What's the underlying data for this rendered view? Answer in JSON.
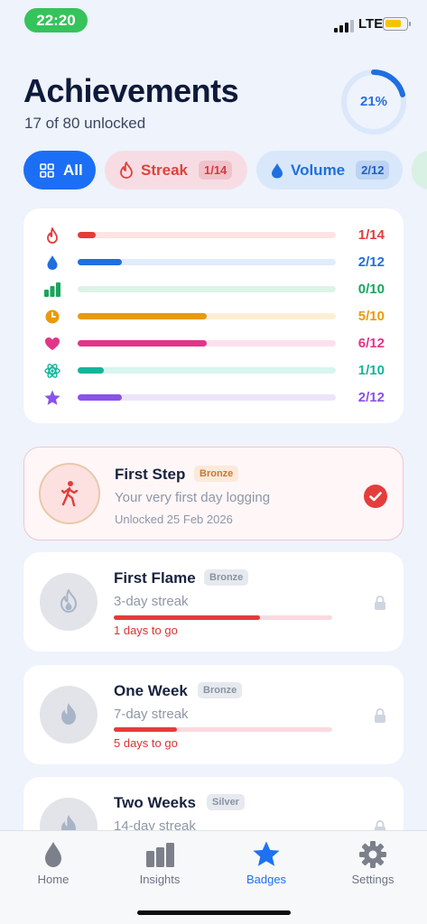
{
  "status": {
    "time": "22:20",
    "network": "LTE"
  },
  "header": {
    "title": "Achievements",
    "subtitle": "17 of 80 unlocked",
    "ring_label": "21%",
    "ring_fraction": 0.21
  },
  "filters": [
    {
      "label": "All",
      "icon": "grid-icon",
      "active": true
    },
    {
      "label": "Streak",
      "count": "1/14",
      "icon": "flame-icon"
    },
    {
      "label": "Volume",
      "count": "2/12",
      "icon": "drop-icon"
    }
  ],
  "categories": [
    {
      "icon": "flame-icon",
      "value": "1/14",
      "fraction": 0.07,
      "color": "#e23c3c",
      "track": "#fde3e3"
    },
    {
      "icon": "drop-icon",
      "value": "2/12",
      "fraction": 0.17,
      "color": "#1f6fe0",
      "track": "#e0ebfb"
    },
    {
      "icon": "bar-chart-icon",
      "value": "0/10",
      "fraction": 0.0,
      "color": "#18a55b",
      "track": "#dcf4e7"
    },
    {
      "icon": "clock-icon",
      "value": "5/10",
      "fraction": 0.5,
      "color": "#e99a0b",
      "track": "#fdefd5"
    },
    {
      "icon": "heart-icon",
      "value": "6/12",
      "fraction": 0.5,
      "color": "#e2358a",
      "track": "#fce0ee"
    },
    {
      "icon": "atom-icon",
      "value": "1/10",
      "fraction": 0.1,
      "color": "#12b59a",
      "track": "#d8f5ef"
    },
    {
      "icon": "star-icon",
      "value": "2/12",
      "fraction": 0.17,
      "color": "#8a52e8",
      "track": "#ede4fb"
    }
  ],
  "badges": [
    {
      "name": "First Step",
      "tier": "Bronze",
      "description": "Your very first day logging",
      "unlocked_text": "Unlocked 25 Feb 2026",
      "icon": "walking-person-icon"
    },
    {
      "name": "First Flame",
      "tier": "Bronze",
      "description": "3-day streak",
      "progress": 0.67,
      "to_go": "1 days to go",
      "icon": "flame-icon"
    },
    {
      "name": "One Week",
      "tier": "Bronze",
      "description": "7-day streak",
      "progress": 0.29,
      "to_go": "5 days to go",
      "icon": "flame-icon"
    },
    {
      "name": "Two Weeks",
      "tier": "Silver",
      "description": "14-day streak",
      "icon": "flame-icon"
    }
  ],
  "tabs": [
    {
      "label": "Home",
      "icon": "drop-icon"
    },
    {
      "label": "Insights",
      "icon": "bar-chart-icon"
    },
    {
      "label": "Badges",
      "icon": "star-icon",
      "active": true
    },
    {
      "label": "Settings",
      "icon": "gear-icon"
    }
  ]
}
